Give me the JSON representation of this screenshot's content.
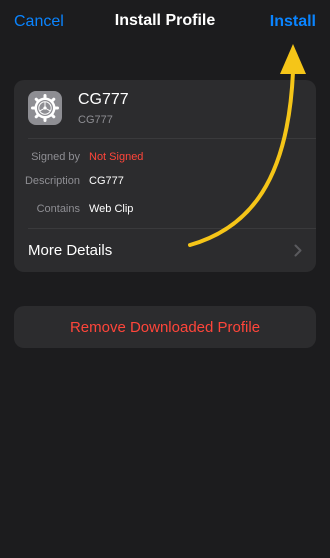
{
  "nav": {
    "cancel_label": "Cancel",
    "title": "Install Profile",
    "install_label": "Install"
  },
  "profile": {
    "name": "CG777",
    "subtitle": "CG777",
    "icon": "gear-icon"
  },
  "details": {
    "signed_by_label": "Signed by",
    "signed_by_value": "Not Signed",
    "description_label": "Description",
    "description_value": "CG777",
    "contains_label": "Contains",
    "contains_value": "Web Clip"
  },
  "more_details_label": "More Details",
  "remove_label": "Remove Downloaded Profile",
  "colors": {
    "accent": "#0a84ff",
    "warning": "#ff453a",
    "annotation_arrow": "#f5c518",
    "background": "#1c1c1e",
    "card": "#2c2c2e"
  }
}
